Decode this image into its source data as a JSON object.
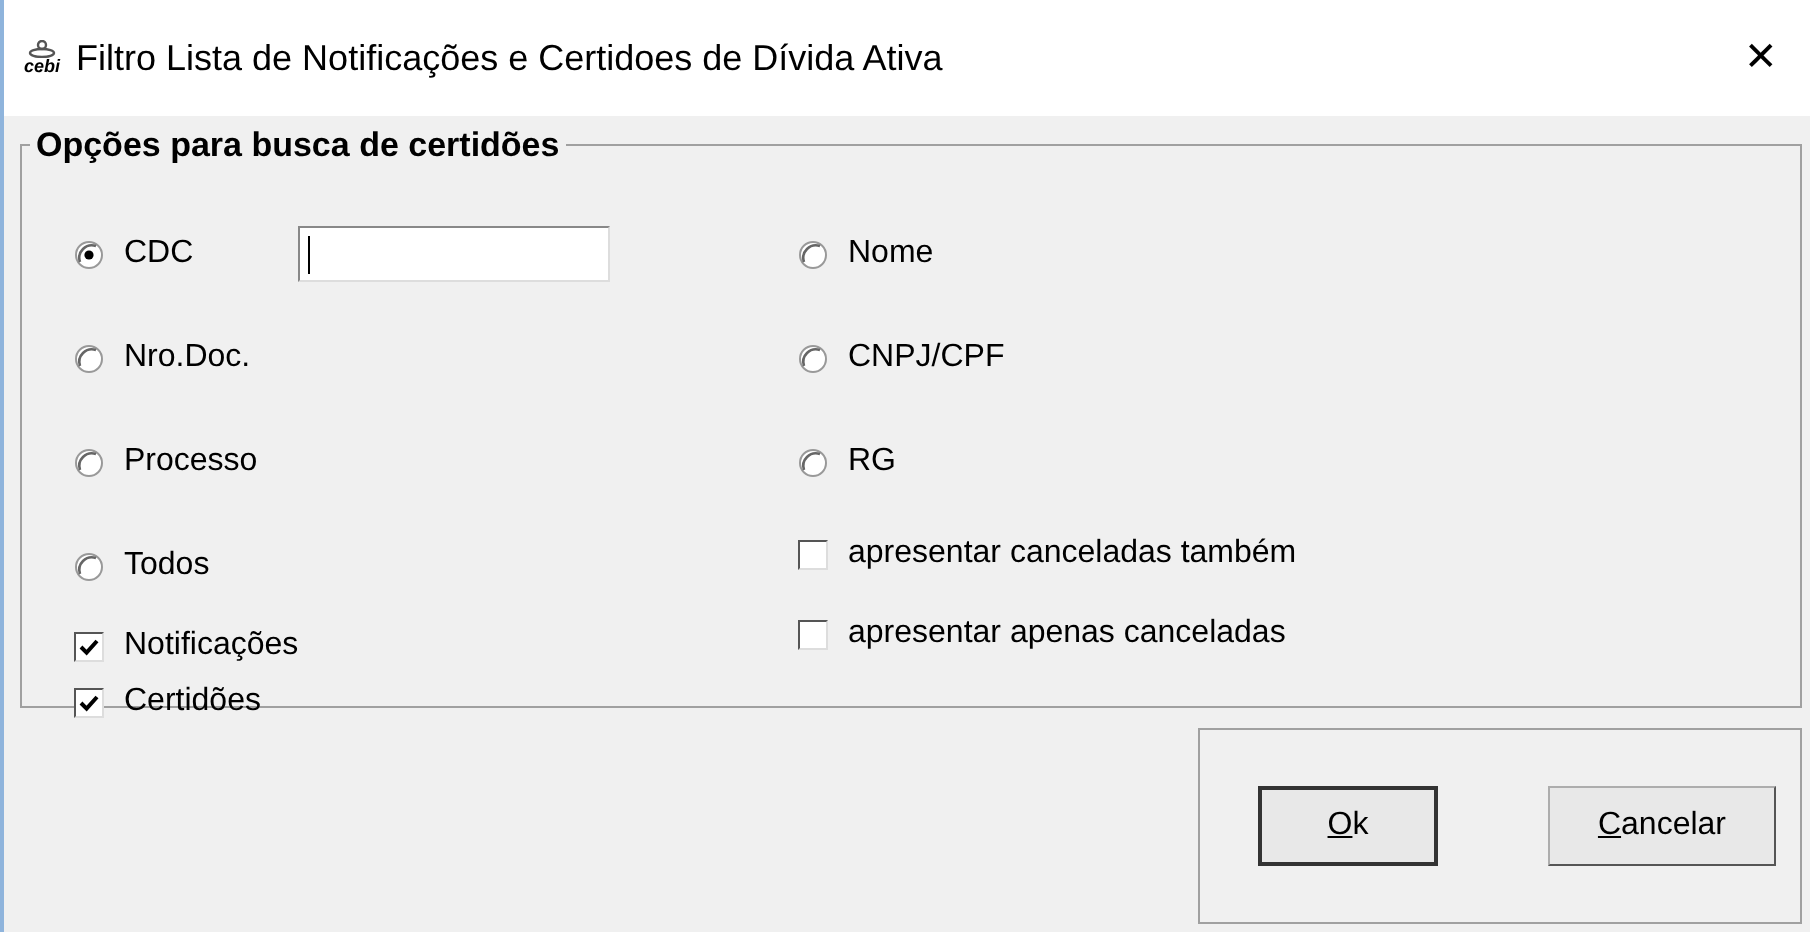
{
  "window": {
    "logo_text": "cebi",
    "title": "Filtro Lista de Notificações e Certidoes de Dívida Ativa",
    "close": "✕"
  },
  "group": {
    "title": "Opções para busca de certidões",
    "left": [
      {
        "kind": "radio",
        "label": "CDC",
        "selected": true,
        "field": {
          "focused": true
        }
      },
      {
        "kind": "radio",
        "label": "Nro.Doc.",
        "selected": false
      },
      {
        "kind": "radio",
        "label": "Processo",
        "selected": false
      },
      {
        "kind": "radio",
        "label": "Todos",
        "selected": false
      },
      {
        "kind": "checkbox",
        "label": "Notificações",
        "checked": true
      },
      {
        "kind": "checkbox",
        "label": "Certidões",
        "checked": true
      }
    ],
    "right": [
      {
        "kind": "radio",
        "label": "Nome",
        "selected": false
      },
      {
        "kind": "radio",
        "label": "CNPJ/CPF",
        "selected": false
      },
      {
        "kind": "radio",
        "label": "RG",
        "selected": false
      },
      {
        "kind": "checkbox",
        "label": "apresentar canceladas também",
        "checked": false
      },
      {
        "kind": "checkbox",
        "label": "apresentar apenas canceladas",
        "checked": false
      }
    ]
  },
  "buttons": [
    {
      "label": "Ok",
      "underline_first": true,
      "default": true
    },
    {
      "label": "Cancelar",
      "underline_first": true,
      "default": false
    }
  ]
}
